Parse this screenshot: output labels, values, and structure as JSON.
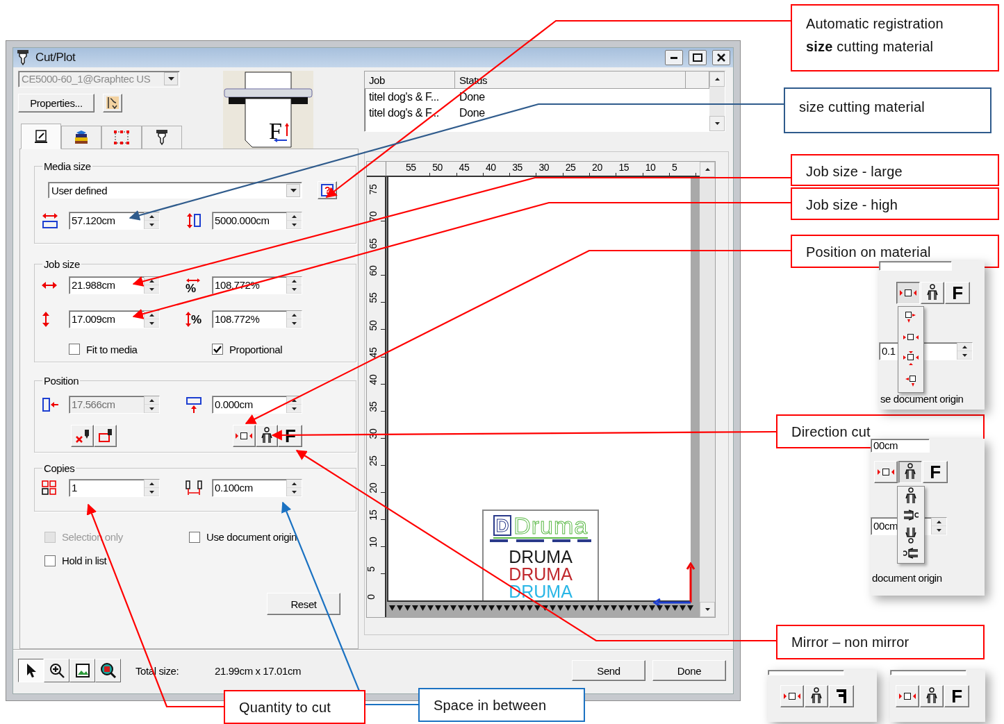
{
  "window": {
    "title": "Cut/Plot"
  },
  "device": {
    "value": "CE5000-60_1@Graphtec US",
    "disabled": true
  },
  "properties_button": "Properties...",
  "plotter_letter": "F",
  "tabs": [
    {
      "selected": true
    },
    {
      "selected": false
    },
    {
      "selected": false
    },
    {
      "selected": false
    }
  ],
  "media_size": {
    "legend": "Media size",
    "preset": "User defined",
    "help_glyph": "?",
    "width": "57.120cm",
    "length": "5000.000cm"
  },
  "job_size": {
    "legend": "Job size",
    "width_percent_sign": "%",
    "height_percent_sign": "%",
    "width": "21.988cm",
    "width_percent": "108.772%",
    "height": "17.009cm",
    "height_percent": "108.772%",
    "options": [
      {
        "label": "Fit to media",
        "checked": false
      },
      {
        "label": "Proportional",
        "checked": true
      }
    ]
  },
  "position": {
    "legend": "Position",
    "x": {
      "value": "17.566cm",
      "disabled": true
    },
    "y": {
      "value": "0.000cm",
      "disabled": false
    },
    "mirror_letter": "F"
  },
  "copies": {
    "legend": "Copies",
    "count": "1",
    "spacing": "0.100cm"
  },
  "options": [
    {
      "label": "Selection only",
      "checked": false,
      "disabled": true
    },
    {
      "label": "Use document origin",
      "checked": false,
      "disabled": false
    },
    {
      "label": "Hold in list",
      "checked": false,
      "disabled": false
    }
  ],
  "reset_button": "Reset",
  "job_list": {
    "columns": [
      "Job",
      "Status"
    ],
    "rows": [
      [
        "titel dog's & F...",
        "Done"
      ],
      [
        "titel dog's & F...",
        "Done"
      ]
    ]
  },
  "preview": {
    "x_ruler": [
      "55",
      "50",
      "45",
      "40",
      "35",
      "30",
      "25",
      "20",
      "15",
      "10",
      "5"
    ],
    "y_ruler": [
      "75",
      "70",
      "65",
      "60",
      "55",
      "50",
      "45",
      "40",
      "35",
      "30",
      "25",
      "20",
      "15",
      "10",
      "5",
      "0"
    ],
    "artwork": {
      "logo_mark": "D",
      "logo": "Druma",
      "lines": [
        {
          "text": "DRUMA",
          "color": "#1a1a1a"
        },
        {
          "text": "DRUMA",
          "color": "#c0282d"
        },
        {
          "text": "DRUMA",
          "color": "#29b6e6"
        }
      ]
    }
  },
  "tools": [
    {
      "selected": true
    },
    {
      "selected": false
    },
    {
      "selected": false
    },
    {
      "selected": false
    }
  ],
  "total_size": {
    "label": "Total size:",
    "value": "21.99cm x 17.01cm"
  },
  "buttons": [
    "Send",
    "Done"
  ],
  "callouts": [
    {
      "text": "Automatic registration\n**size** cutting material",
      "color": "#ff0000"
    },
    {
      "text": "size cutting material",
      "color": "#2f5b8c"
    },
    {
      "text": "Job size - large",
      "color": "#ff0000"
    },
    {
      "text": "Job size - high",
      "color": "#ff0000"
    },
    {
      "text": "Position on material",
      "color": "#ff0000"
    },
    {
      "text": "Direction cut",
      "color": "#ff0000"
    },
    {
      "text": "Mirror – non mirror",
      "color": "#ff0000"
    },
    {
      "text": "Quantity to cut",
      "color": "#ff0000"
    },
    {
      "text": "Space in between",
      "color": "#1b72c2"
    }
  ],
  "insets": [
    {
      "kind": "position",
      "letter": "F",
      "field_value": "0.1",
      "caption": "se document origin"
    },
    {
      "kind": "direction",
      "letter": "F",
      "top_value": "00cm",
      "field_value": "00cm",
      "caption": "document origin"
    },
    {
      "kind": "mirror",
      "mirrored": true
    },
    {
      "kind": "mirror",
      "letter": "F",
      "mirrored": false
    }
  ]
}
